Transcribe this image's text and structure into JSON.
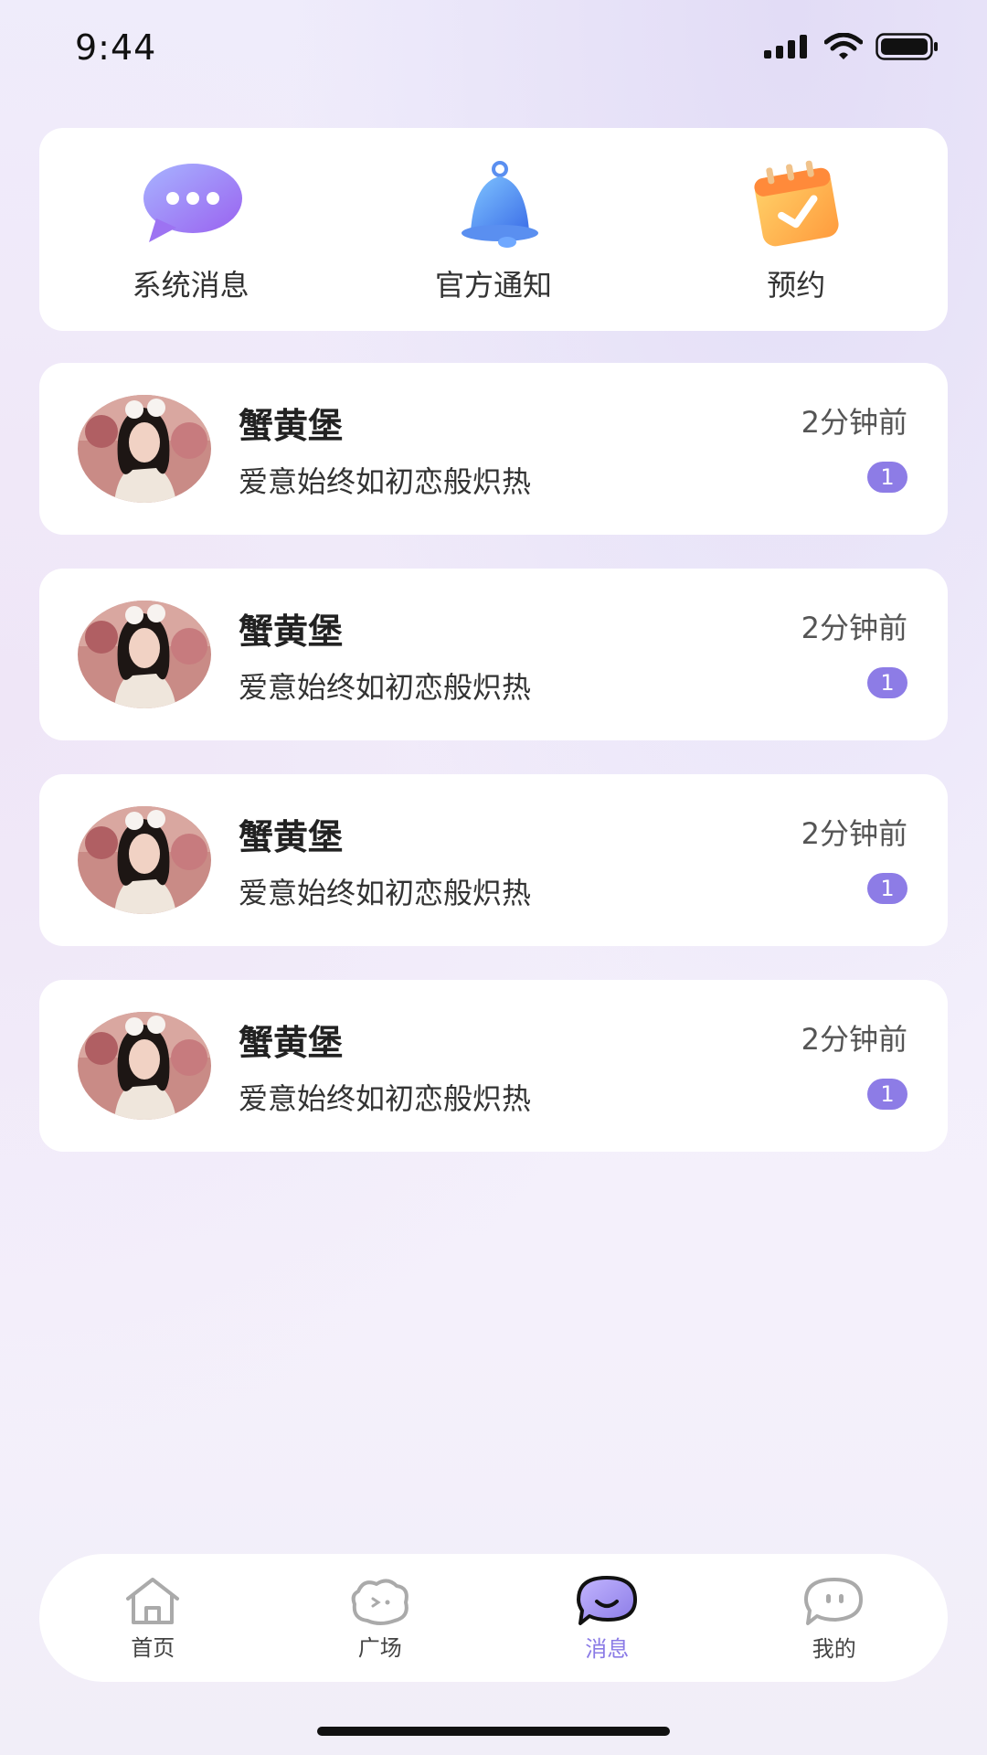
{
  "status_bar": {
    "time": "9:44"
  },
  "quick_entries": [
    {
      "label": "系统消息",
      "icon": "chat-bubble-icon"
    },
    {
      "label": "官方通知",
      "icon": "bell-icon"
    },
    {
      "label": "预约",
      "icon": "calendar-check-icon"
    }
  ],
  "messages": [
    {
      "name": "蟹黄堡",
      "text": "爱意始终如初恋般炽热",
      "time": "2分钟前",
      "badge": "1"
    },
    {
      "name": "蟹黄堡",
      "text": "爱意始终如初恋般炽热",
      "time": "2分钟前",
      "badge": "1"
    },
    {
      "name": "蟹黄堡",
      "text": "爱意始终如初恋般炽热",
      "time": "2分钟前",
      "badge": "1"
    },
    {
      "name": "蟹黄堡",
      "text": "爱意始终如初恋般炽热",
      "time": "2分钟前",
      "badge": "1"
    }
  ],
  "tabbar": {
    "items": [
      {
        "label": "首页",
        "icon": "home-icon",
        "active": false
      },
      {
        "label": "广场",
        "icon": "plaza-icon",
        "active": false
      },
      {
        "label": "消息",
        "icon": "message-icon",
        "active": true
      },
      {
        "label": "我的",
        "icon": "profile-icon",
        "active": false
      }
    ]
  },
  "colors": {
    "accent": "#8d7ce6",
    "badge": "#8d7ce6",
    "text": "#222222"
  }
}
